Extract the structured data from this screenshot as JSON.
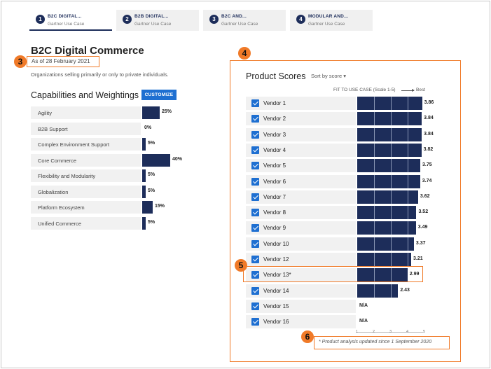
{
  "tabs": [
    {
      "num": "1",
      "title": "B2C DIGITAL...",
      "sub": "Gartner Use Case"
    },
    {
      "num": "2",
      "title": "B2B DIGITAL...",
      "sub": "Gartner Use Case"
    },
    {
      "num": "3",
      "title": "B2C AND...",
      "sub": "Gartner Use Case"
    },
    {
      "num": "4",
      "title": "MODULAR AND...",
      "sub": "Gartner Use Case"
    }
  ],
  "page": {
    "title": "B2C Digital Commerce",
    "as_of": "As of 28 February 2021",
    "description": "Organizations selling primarily or only to private individuals."
  },
  "capabilities": {
    "title": "Capabilities and Weightings",
    "customize_label": "CUSTOMIZE",
    "rows": [
      {
        "label": "Agility",
        "pct": "25%",
        "value": 25
      },
      {
        "label": "B2B Support",
        "pct": "0%",
        "value": 0
      },
      {
        "label": "Complex Environment Support",
        "pct": "5%",
        "value": 5
      },
      {
        "label": "Core Commerce",
        "pct": "40%",
        "value": 40
      },
      {
        "label": "Flexibility and Modularity",
        "pct": "5%",
        "value": 5
      },
      {
        "label": "Globalization",
        "pct": "5%",
        "value": 5
      },
      {
        "label": "Platform Ecosystem",
        "pct": "15%",
        "value": 15
      },
      {
        "label": "Unified Commerce",
        "pct": "5%",
        "value": 5
      }
    ]
  },
  "badges": {
    "b3": "3",
    "b4": "4",
    "b5": "5",
    "b6": "6"
  },
  "scores": {
    "title": "Product Scores",
    "sort_label": "Sort by score",
    "fit_label": "FIT TO USE CASE (Scale 1-5)",
    "best_label": "Best",
    "axis_ticks": [
      "1",
      "2",
      "3",
      "4",
      "5"
    ],
    "footnote": "* Product analysis updated since 1 September 2020",
    "vendors": [
      {
        "name": "Vendor 1",
        "score": "3.86",
        "value": 3.86
      },
      {
        "name": "Vendor 2",
        "score": "3.84",
        "value": 3.84
      },
      {
        "name": "Vendor 3",
        "score": "3.84",
        "value": 3.84
      },
      {
        "name": "Vendor 4",
        "score": "3.82",
        "value": 3.82
      },
      {
        "name": "Vendor 5",
        "score": "3.75",
        "value": 3.75
      },
      {
        "name": "Vendor 6",
        "score": "3.74",
        "value": 3.74
      },
      {
        "name": "Vendor 7",
        "score": "3.62",
        "value": 3.62
      },
      {
        "name": "Vendor 8",
        "score": "3.52",
        "value": 3.52
      },
      {
        "name": "Vendor 9",
        "score": "3.49",
        "value": 3.49
      },
      {
        "name": "Vendor 10",
        "score": "3.37",
        "value": 3.37
      },
      {
        "name": "Vendor 12",
        "score": "3.21",
        "value": 3.21
      },
      {
        "name": "Vendor 13*",
        "score": "2.99",
        "value": 2.99
      },
      {
        "name": "Vendor 14",
        "score": "2.43",
        "value": 2.43
      },
      {
        "name": "Vendor 15",
        "score": "N/A",
        "value": null
      },
      {
        "name": "Vendor 16",
        "score": "N/A",
        "value": null
      }
    ]
  },
  "colors": {
    "bar": "#1d2d5a",
    "accent": "#1e6fd1",
    "highlight": "#f07a28"
  }
}
